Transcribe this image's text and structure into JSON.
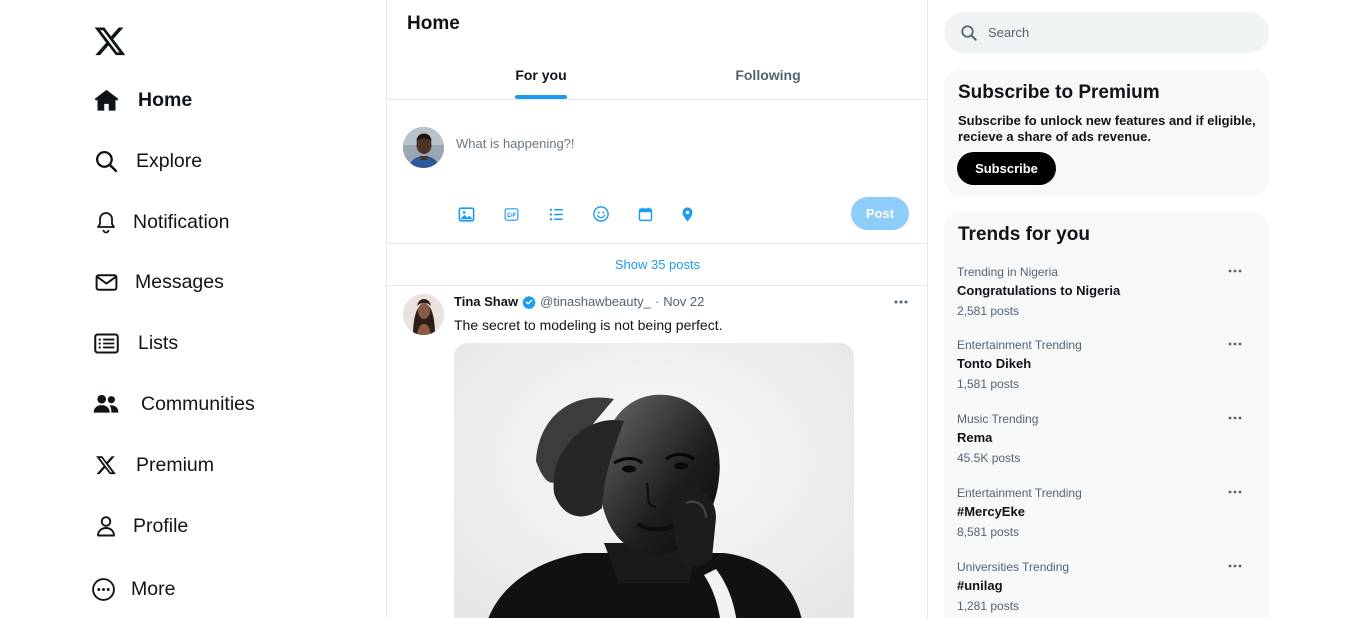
{
  "nav": {
    "items": [
      {
        "label": "Home",
        "icon": "home-icon"
      },
      {
        "label": "Explore",
        "icon": "search-icon"
      },
      {
        "label": "Notification",
        "icon": "bell-icon"
      },
      {
        "label": "Messages",
        "icon": "envelope-icon"
      },
      {
        "label": "Lists",
        "icon": "list-icon"
      },
      {
        "label": "Communities",
        "icon": "people-icon"
      },
      {
        "label": "Premium",
        "icon": "x-logo-icon"
      },
      {
        "label": "Profile",
        "icon": "person-icon"
      },
      {
        "label": "More",
        "icon": "more-circle-icon"
      }
    ]
  },
  "header": {
    "title": "Home"
  },
  "tabs": [
    {
      "label": "For you",
      "active": true
    },
    {
      "label": "Following",
      "active": false
    }
  ],
  "composer": {
    "placeholder": "What is happening?!",
    "post_label": "Post",
    "tools": [
      "image-icon",
      "gif-icon",
      "poll-icon",
      "emoji-icon",
      "schedule-icon",
      "location-icon"
    ]
  },
  "feed": {
    "show_posts": "Show 35 posts"
  },
  "tweet": {
    "name": "Tina Shaw",
    "handle": "@tinashawbeauty_",
    "dot": "·",
    "date": "Nov 22",
    "text": "The secret to modeling is not being perfect."
  },
  "search": {
    "placeholder": "Search"
  },
  "premium": {
    "title": "Subscribe to Premium",
    "text": "Subscribe fo unlock new features and if eligible, recieve a share of ads revenue.",
    "button": "Subscribe"
  },
  "trends": {
    "title": "Trends for you",
    "items": [
      {
        "category": "Trending in Nigeria",
        "name": "Congratulations to Nigeria",
        "count": "2,581 posts"
      },
      {
        "category": "Entertainment Trending",
        "name": "Tonto Dikeh",
        "count": "1,581 posts"
      },
      {
        "category": "Music Trending",
        "name": "Rema",
        "count": "45.5K posts"
      },
      {
        "category": "Entertainment Trending",
        "name": "#MercyEke",
        "count": "8,581 posts"
      },
      {
        "category": "Universities Trending",
        "name": "#unilag",
        "count": "1,281 posts"
      }
    ]
  },
  "colors": {
    "accent": "#1d9bf0",
    "text": "#0f1419",
    "muted": "#536471",
    "panel": "#f7f9f9"
  }
}
